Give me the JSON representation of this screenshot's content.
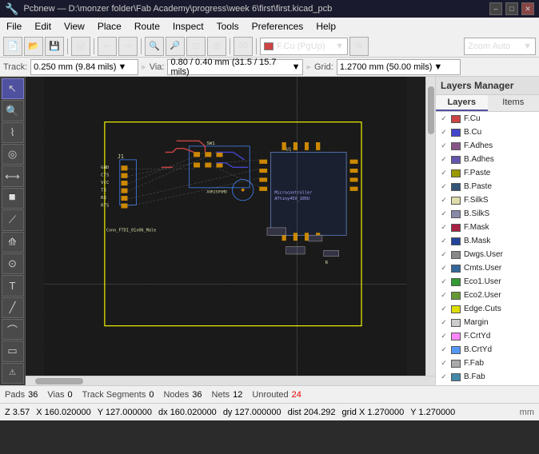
{
  "titlebar": {
    "title": "Pcbnew — D:\\monzer folder\\Fab Academy\\progress\\week 6\\first\\first.kicad_pcb",
    "min": "–",
    "max": "□",
    "close": "✕"
  },
  "menubar": {
    "items": [
      "File",
      "Edit",
      "View",
      "Place",
      "Route",
      "Inspect",
      "Tools",
      "Preferences",
      "Help"
    ]
  },
  "toolbar1": {
    "layer_dropdown": "F.Cu (PgUp)",
    "zoom_dropdown": "Zoom Auto"
  },
  "toolbar2": {
    "track_label": "Track:",
    "track_val": "0.250 mm (9.84 mils)",
    "via_label": "Via:",
    "via_val": "0.80 / 0.40 mm (31.5 / 15.7 mils)",
    "grid_label": "Grid:",
    "grid_val": "1.2700 mm (50.00 mils)"
  },
  "layers_panel": {
    "title": "Layers Manager",
    "tabs": [
      "Layers",
      "Items"
    ],
    "active_tab": "Layers",
    "layers": [
      {
        "name": "F.Cu",
        "color": "#cc4444",
        "visible": true,
        "selected": false
      },
      {
        "name": "B.Cu",
        "color": "#4444cc",
        "visible": true,
        "selected": false
      },
      {
        "name": "F.Adhes",
        "color": "#885588",
        "visible": true,
        "selected": false
      },
      {
        "name": "B.Adhes",
        "color": "#6655aa",
        "visible": true,
        "selected": false
      },
      {
        "name": "F.Paste",
        "color": "#999900",
        "visible": true,
        "selected": false
      },
      {
        "name": "B.Paste",
        "color": "#335577",
        "visible": true,
        "selected": false
      },
      {
        "name": "F.SilkS",
        "color": "#ddddaa",
        "visible": true,
        "selected": false
      },
      {
        "name": "B.SilkS",
        "color": "#8888aa",
        "visible": true,
        "selected": false
      },
      {
        "name": "F.Mask",
        "color": "#aa2244",
        "visible": true,
        "selected": false
      },
      {
        "name": "B.Mask",
        "color": "#224499",
        "visible": true,
        "selected": false
      },
      {
        "name": "Dwgs.User",
        "color": "#888888",
        "visible": true,
        "selected": false
      },
      {
        "name": "Cmts.User",
        "color": "#336699",
        "visible": true,
        "selected": false
      },
      {
        "name": "Eco1.User",
        "color": "#339933",
        "visible": true,
        "selected": false
      },
      {
        "name": "Eco2.User",
        "color": "#669933",
        "visible": true,
        "selected": false
      },
      {
        "name": "Edge.Cuts",
        "color": "#dddd00",
        "visible": true,
        "selected": false
      },
      {
        "name": "Margin",
        "color": "#cccccc",
        "visible": true,
        "selected": false
      },
      {
        "name": "F.CrtYd",
        "color": "#ff88ff",
        "visible": true,
        "selected": false
      },
      {
        "name": "B.CrtYd",
        "color": "#5599ff",
        "visible": true,
        "selected": false
      },
      {
        "name": "F.Fab",
        "color": "#aaaaaa",
        "visible": true,
        "selected": false
      },
      {
        "name": "B.Fab",
        "color": "#4488aa",
        "visible": true,
        "selected": false
      }
    ]
  },
  "statusbar": {
    "pads_label": "Pads",
    "pads_val": "36",
    "vias_label": "Vias",
    "vias_val": "0",
    "track_segs_label": "Track Segments",
    "track_segs_val": "0",
    "nodes_label": "Nodes",
    "nodes_val": "36",
    "nets_label": "Nets",
    "nets_val": "12",
    "unrouted_label": "Unrouted",
    "unrouted_val": "24"
  },
  "coordbar": {
    "z": "Z 3.57",
    "x": "X 160.020000",
    "y": "Y 127.000000",
    "dx": "dx 160.020000",
    "dy": "dy 127.000000",
    "dist": "dist 204.292",
    "grid_x": "grid X 1.270000",
    "grid_y": "Y 1.270000",
    "unit": "mm"
  },
  "pcb": {
    "component_labels": [
      "J1",
      "SW1",
      "U1",
      "GND",
      "CTS",
      "VCC",
      "TX",
      "RX",
      "RTS",
      "Conn_FTDI_01x06_Male",
      "R",
      "AVRISPSMD",
      "Microcontroller_ATiny45V_105U"
    ]
  },
  "icons": {
    "cursor": "↖",
    "zoom_in": "+",
    "zoom_out": "–",
    "fit": "⊡",
    "grid": "⊞",
    "highlight": "◎",
    "route": "⌇",
    "via": "⊙",
    "add_track": "⟋",
    "inspect": "🔍",
    "3d": "◰",
    "measure": "⟷",
    "snap": "⊕"
  }
}
